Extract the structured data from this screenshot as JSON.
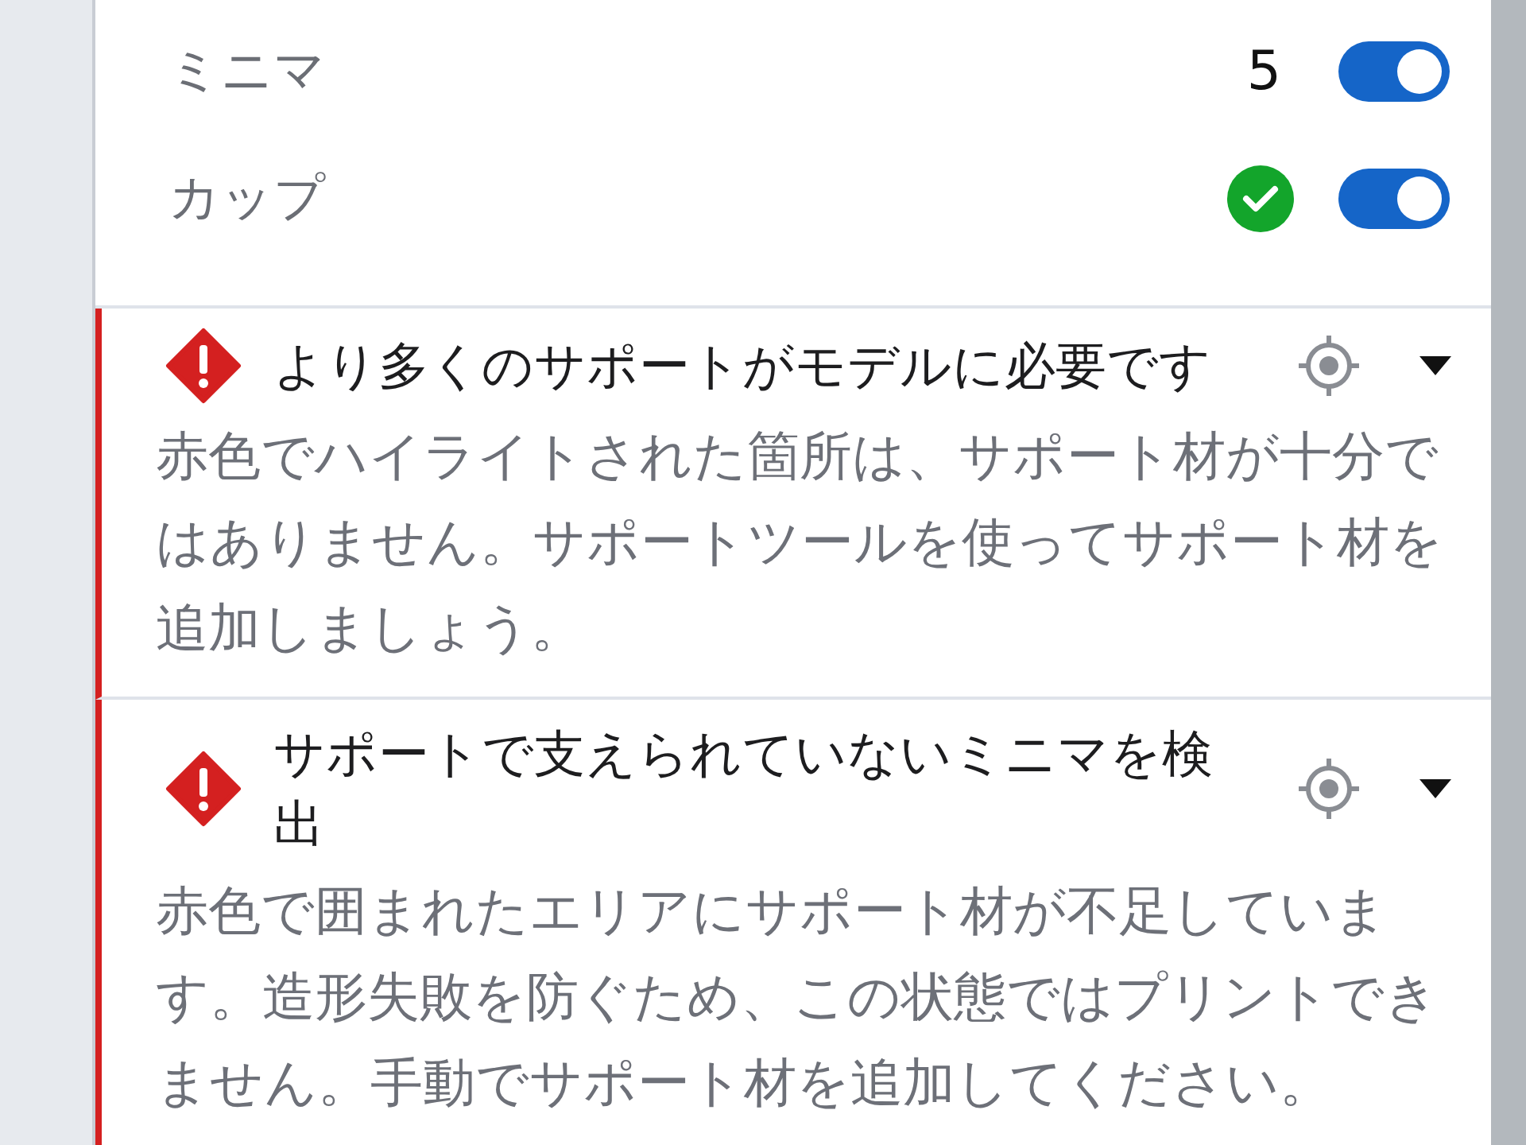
{
  "settings": [
    {
      "label": "ミニマ",
      "kind": "count",
      "value": "5",
      "on": true
    },
    {
      "label": "カップ",
      "kind": "check",
      "on": true
    }
  ],
  "alerts": [
    {
      "kind": "error",
      "title": "より多くのサポートがモデルに必要です",
      "message": "赤色でハイライトされた箇所は、サポート材が十分ではありません。サポートツールを使ってサポート材を追加しましょう。"
    },
    {
      "kind": "error",
      "title": "サポートで支えられていないミニマを検出",
      "message": "赤色で囲まれたエリアにサポート材が不足しています。造形失敗を防ぐため、この状態ではプリントできません。手動でサポート材を追加してください。"
    }
  ]
}
